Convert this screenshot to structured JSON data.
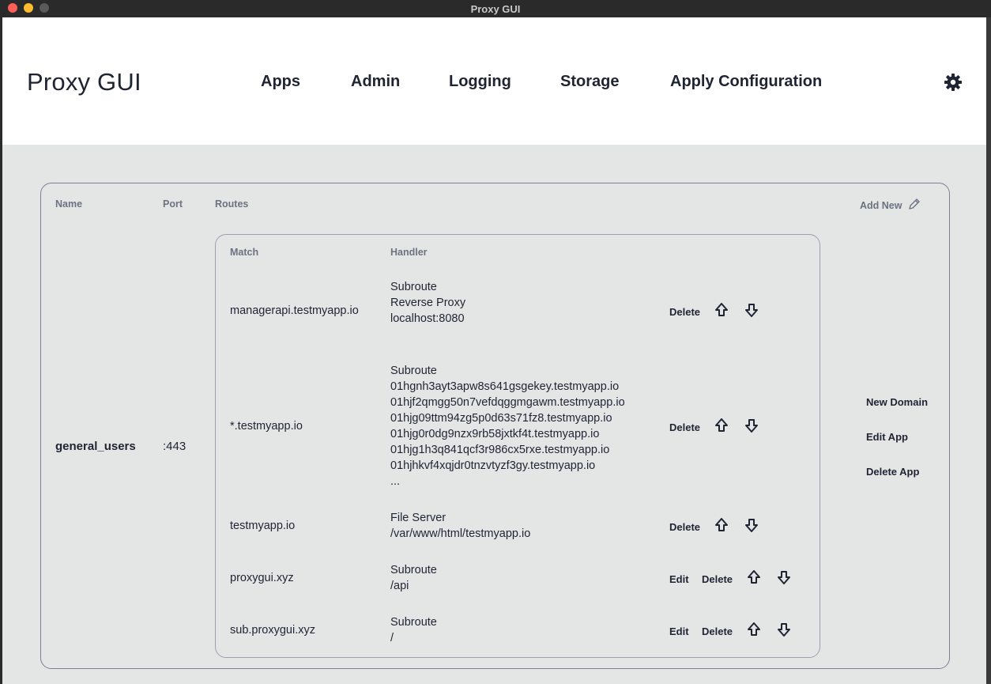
{
  "window": {
    "title": "Proxy GUI"
  },
  "nav": {
    "brand": "Proxy GUI",
    "links": [
      "Apps",
      "Admin",
      "Logging",
      "Storage",
      "Apply Configuration"
    ],
    "settings_icon": "gear-icon"
  },
  "apps_table": {
    "headers": {
      "name": "Name",
      "port": "Port",
      "routes": "Routes"
    },
    "add_new": "Add New",
    "add_new_icon": "pencil-icon",
    "app": {
      "name": "general_users",
      "port": ":443",
      "actions": [
        "New Domain",
        "Edit App",
        "Delete App"
      ],
      "routes_table": {
        "headers": {
          "match": "Match",
          "handler": "Handler"
        },
        "rows": [
          {
            "match": "managerapi.testmyapp.io",
            "handler": [
              "Subroute",
              "Reverse Proxy",
              "localhost:8080"
            ],
            "edit": "",
            "delete": "Delete"
          },
          {
            "match": "*.testmyapp.io",
            "handler": [
              "Subroute",
              "01hgnh3ayt3apw8s641gsgekey.testmyapp.io",
              "01hjf2qmgg50n7vefdqggmgawm.testmyapp.io",
              "01hjg09ttm94zg5p0d63s71fz8.testmyapp.io",
              "01hjg0r0dg9nzx9rb58jxtkf4t.testmyapp.io",
              "01hjg1h3q841qcf3r986cx5rxe.testmyapp.io",
              "01hjhkvf4xqjdr0tnzvtyzf3gy.testmyapp.io",
              "..."
            ],
            "edit": "",
            "delete": "Delete"
          },
          {
            "match": "testmyapp.io",
            "handler": [
              "File Server",
              "/var/www/html/testmyapp.io"
            ],
            "edit": "",
            "delete": "Delete"
          },
          {
            "match": "proxygui.xyz",
            "handler": [
              "Subroute",
              "/api"
            ],
            "edit": "Edit",
            "delete": "Delete"
          },
          {
            "match": "sub.proxygui.xyz",
            "handler": [
              "Subroute",
              "/"
            ],
            "edit": "Edit",
            "delete": "Delete"
          }
        ]
      }
    }
  },
  "colors": {
    "background": "#e4e6e6",
    "navbar": "#ffffff",
    "text": "#1f2433",
    "muted": "#6b7280",
    "border": "#7b8196"
  }
}
